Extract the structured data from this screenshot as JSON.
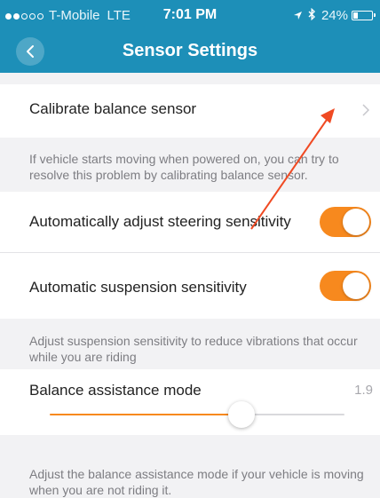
{
  "status_bar": {
    "signal_dots": [
      true,
      true,
      false,
      false,
      false
    ],
    "carrier": "T-Mobile",
    "network": "LTE",
    "time": "7:01 PM",
    "battery": "24%",
    "battery_level": 0.24,
    "icons": [
      "location-arrow-icon",
      "bluetooth-icon"
    ]
  },
  "nav": {
    "title": "Sensor Settings",
    "back_icon": "chevron-left-icon"
  },
  "settings": {
    "calibrate": {
      "label": "Calibrate balance sensor",
      "caption": "If vehicle starts moving when powered on, you can try to resolve this problem by calibrating balance sensor."
    },
    "steering": {
      "label": "Automatically adjust steering sensitivity",
      "enabled": true
    },
    "suspension": {
      "label": "Automatic suspension sensitivity",
      "enabled": true,
      "caption": "Adjust suspension sensitivity to reduce vibrations that occur while you are riding"
    },
    "balance_assistance": {
      "label": "Balance assistance mode",
      "value": "1.9",
      "fraction": 0.65,
      "caption": "Adjust the balance assistance mode if your vehicle is moving when you are not riding it."
    }
  },
  "colors": {
    "header": "#1d8fb8",
    "accent": "#f7891e",
    "annotation_arrow": "#f04a23"
  }
}
